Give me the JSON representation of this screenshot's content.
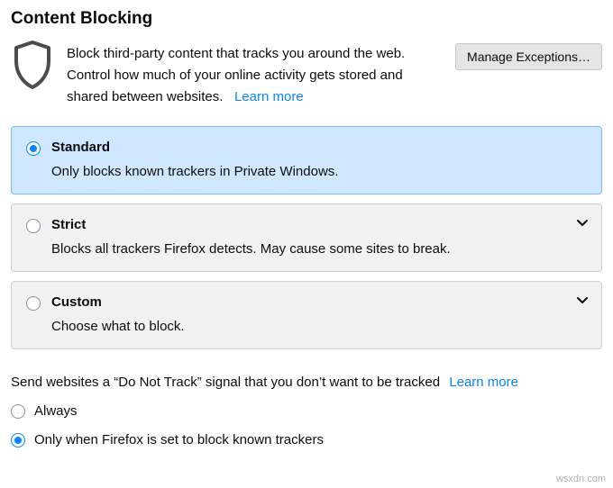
{
  "section": {
    "title": "Content Blocking",
    "intro": "Block third-party content that tracks you around the web. Control how much of your online activity gets stored and shared between websites.",
    "learn_more": "Learn more",
    "manage_button": "Manage Exceptions…"
  },
  "options": [
    {
      "id": "standard",
      "title": "Standard",
      "desc": "Only blocks known trackers in Private Windows.",
      "selected": true,
      "expandable": false
    },
    {
      "id": "strict",
      "title": "Strict",
      "desc": "Blocks all trackers Firefox detects. May cause some sites to break.",
      "selected": false,
      "expandable": true
    },
    {
      "id": "custom",
      "title": "Custom",
      "desc": "Choose what to block.",
      "selected": false,
      "expandable": true
    }
  ],
  "dnt": {
    "label": "Send websites a “Do Not Track” signal that you don’t want to be tracked",
    "learn_more": "Learn more",
    "options": [
      {
        "id": "always",
        "label": "Always",
        "selected": false
      },
      {
        "id": "only-block",
        "label": "Only when Firefox is set to block known trackers",
        "selected": true
      }
    ]
  },
  "watermark": "wsxdn.com"
}
